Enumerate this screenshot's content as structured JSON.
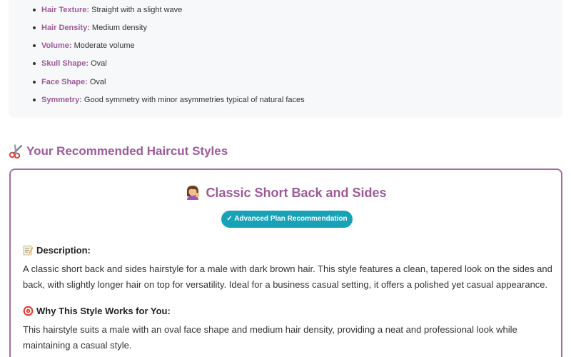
{
  "analysis": {
    "items": [
      {
        "name": "Hair Texture:",
        "value": "Straight with a slight wave"
      },
      {
        "name": "Hair Density:",
        "value": "Medium density"
      },
      {
        "name": "Volume:",
        "value": "Moderate volume"
      },
      {
        "name": "Skull Shape:",
        "value": "Oval"
      },
      {
        "name": "Face Shape:",
        "value": "Oval"
      },
      {
        "name": "Symmetry:",
        "value": "Good symmetry with minor asymmetries typical of natural faces"
      }
    ]
  },
  "recommendations": {
    "heading": "Your Recommended Haircut Styles",
    "heading_icon": "scissors-icon",
    "card": {
      "title": "Classic Short Back and Sides",
      "title_icon": "person-getting-haircut-icon",
      "badge": "✓ Advanced Plan Recommendation",
      "description_heading": "Description:",
      "description": "A classic short back and sides hairstyle for a male with dark brown hair. This style features a clean, tapered look on the sides and back, with slightly longer hair on top for versatility. Ideal for a business casual setting, it offers a polished yet casual appearance.",
      "why_heading": "Why This Style Works for You:",
      "why": "This hairstyle suits a male with an oval face shape and medium hair density, providing a neat and professional look while maintaining a casual style."
    }
  },
  "colors": {
    "accent": "#9c5b98",
    "card_border": "#a56da2",
    "badge": "#17a2b8",
    "panel_bg": "#f7f8fa"
  }
}
